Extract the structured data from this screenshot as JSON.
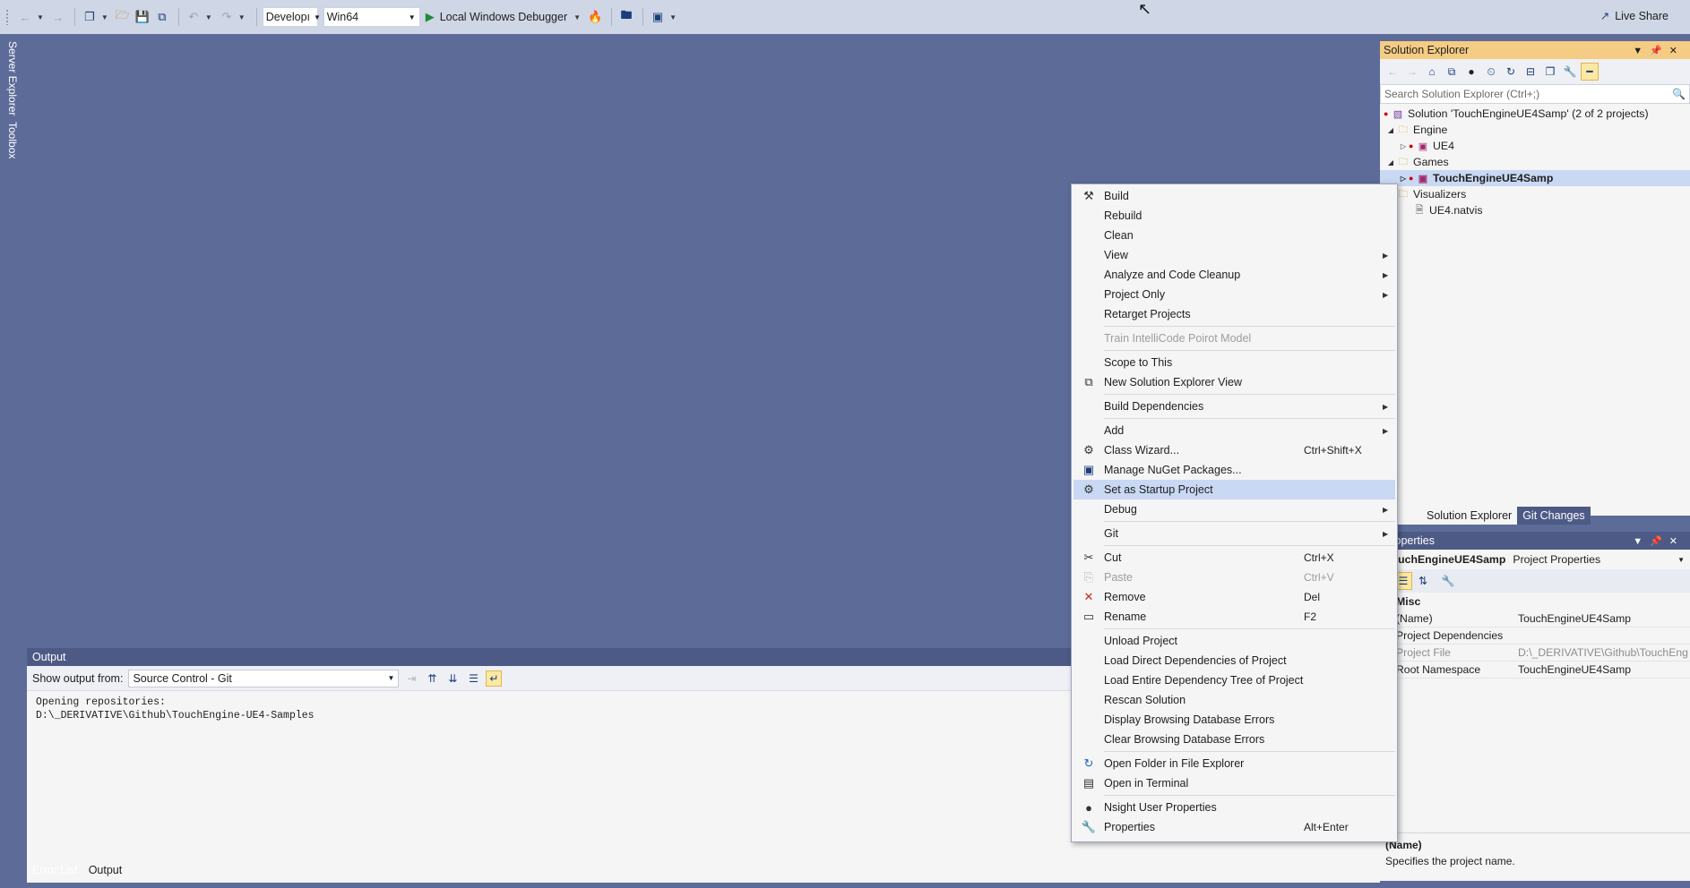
{
  "toolbar": {
    "config_value": "Developı",
    "platform_value": "Win64",
    "debugger_label": "Local Windows Debugger",
    "live_share_label": "Live Share"
  },
  "left_tabs": {
    "server_explorer": "Server Explorer",
    "toolbox": "Toolbox"
  },
  "solution_explorer": {
    "title": "Solution Explorer",
    "search_placeholder": "Search Solution Explorer (Ctrl+;)",
    "tree": [
      {
        "label": "Solution 'TouchEngineUE4Samp' (2 of 2 projects)",
        "icon": "solution-icon"
      },
      {
        "label": "Engine",
        "icon": "folder-icon"
      },
      {
        "label": "UE4",
        "icon": "project-icon"
      },
      {
        "label": "Games",
        "icon": "folder-icon"
      },
      {
        "label": "TouchEngineUE4Samp",
        "icon": "project-icon",
        "selected": true
      },
      {
        "label": "Visualizers",
        "icon": "folder-icon"
      },
      {
        "label": "UE4.natvis",
        "icon": "file-icon"
      }
    ],
    "tabs": [
      "Solution Explorer",
      "Git Changes"
    ]
  },
  "properties": {
    "title": "Properties",
    "object_name": "TouchEngineUE4Samp",
    "object_type": "Project Properties",
    "category": "Misc",
    "rows": [
      {
        "key": "(Name)",
        "value": "TouchEngineUE4Samp"
      },
      {
        "key": "Project Dependencies",
        "value": ""
      },
      {
        "key": "Project File",
        "value": "D:\\_DERIVATIVE\\Github\\TouchEng"
      },
      {
        "key": "Root Namespace",
        "value": "TouchEngineUE4Samp"
      }
    ],
    "desc_title": "(Name)",
    "desc_text": "Specifies the project name."
  },
  "output": {
    "title": "Output",
    "show_from_label": "Show output from:",
    "source_value": "Source Control - Git",
    "text": "Opening repositories:\nD:\\_DERIVATIVE\\Github\\TouchEngine-UE4-Samples",
    "bottom_tabs": [
      "Error List",
      "Output"
    ]
  },
  "context_menu": {
    "items": [
      {
        "label": "Build",
        "icon": "build-icon",
        "shortcut": "",
        "submenu": false
      },
      {
        "label": "Rebuild",
        "icon": "",
        "shortcut": "",
        "submenu": false
      },
      {
        "label": "Clean",
        "icon": "",
        "shortcut": "",
        "submenu": false
      },
      {
        "label": "View",
        "icon": "",
        "shortcut": "",
        "submenu": true
      },
      {
        "label": "Analyze and Code Cleanup",
        "icon": "",
        "shortcut": "",
        "submenu": true
      },
      {
        "label": "Project Only",
        "icon": "",
        "shortcut": "",
        "submenu": true
      },
      {
        "label": "Retarget Projects",
        "icon": "",
        "shortcut": "",
        "submenu": false
      },
      {
        "label": "Train IntelliCode Poirot Model",
        "icon": "",
        "shortcut": "",
        "submenu": false,
        "disabled": true
      },
      {
        "label": "Scope to This",
        "icon": "",
        "shortcut": "",
        "submenu": false
      },
      {
        "label": "New Solution Explorer View",
        "icon": "new-view-icon",
        "shortcut": "",
        "submenu": false
      },
      {
        "label": "Build Dependencies",
        "icon": "",
        "shortcut": "",
        "submenu": true
      },
      {
        "label": "Add",
        "icon": "",
        "shortcut": "",
        "submenu": true
      },
      {
        "label": "Class Wizard...",
        "icon": "class-wizard-icon",
        "shortcut": "Ctrl+Shift+X",
        "submenu": false
      },
      {
        "label": "Manage NuGet Packages...",
        "icon": "nuget-icon",
        "shortcut": "",
        "submenu": false
      },
      {
        "label": "Set as Startup Project",
        "icon": "gear-icon",
        "shortcut": "",
        "submenu": false,
        "highlighted": true
      },
      {
        "label": "Debug",
        "icon": "",
        "shortcut": "",
        "submenu": true
      },
      {
        "label": "Git",
        "icon": "",
        "shortcut": "",
        "submenu": true
      },
      {
        "label": "Cut",
        "icon": "scissors-icon",
        "shortcut": "Ctrl+X",
        "submenu": false
      },
      {
        "label": "Paste",
        "icon": "paste-icon",
        "shortcut": "Ctrl+V",
        "submenu": false,
        "disabled": true
      },
      {
        "label": "Remove",
        "icon": "remove-icon",
        "shortcut": "Del",
        "submenu": false
      },
      {
        "label": "Rename",
        "icon": "rename-icon",
        "shortcut": "F2",
        "submenu": false
      },
      {
        "label": "Unload Project",
        "icon": "",
        "shortcut": "",
        "submenu": false
      },
      {
        "label": "Load Direct Dependencies of Project",
        "icon": "",
        "shortcut": "",
        "submenu": false
      },
      {
        "label": "Load Entire Dependency Tree of Project",
        "icon": "",
        "shortcut": "",
        "submenu": false
      },
      {
        "label": "Rescan Solution",
        "icon": "",
        "shortcut": "",
        "submenu": false
      },
      {
        "label": "Display Browsing Database Errors",
        "icon": "",
        "shortcut": "",
        "submenu": false
      },
      {
        "label": "Clear Browsing Database Errors",
        "icon": "",
        "shortcut": "",
        "submenu": false
      },
      {
        "label": "Open Folder in File Explorer",
        "icon": "open-folder-icon",
        "shortcut": "",
        "submenu": false
      },
      {
        "label": "Open in Terminal",
        "icon": "terminal-icon",
        "shortcut": "",
        "submenu": false
      },
      {
        "label": "Nsight User Properties",
        "icon": "nsight-icon",
        "shortcut": "",
        "submenu": false
      },
      {
        "label": "Properties",
        "icon": "wrench-icon",
        "shortcut": "Alt+Enter",
        "submenu": false
      }
    ]
  },
  "colors": {
    "background": "#5d6b99",
    "toolbar": "#cfd6e5",
    "accent_tab": "#f5cc84",
    "selection": "#c9d8f3"
  }
}
